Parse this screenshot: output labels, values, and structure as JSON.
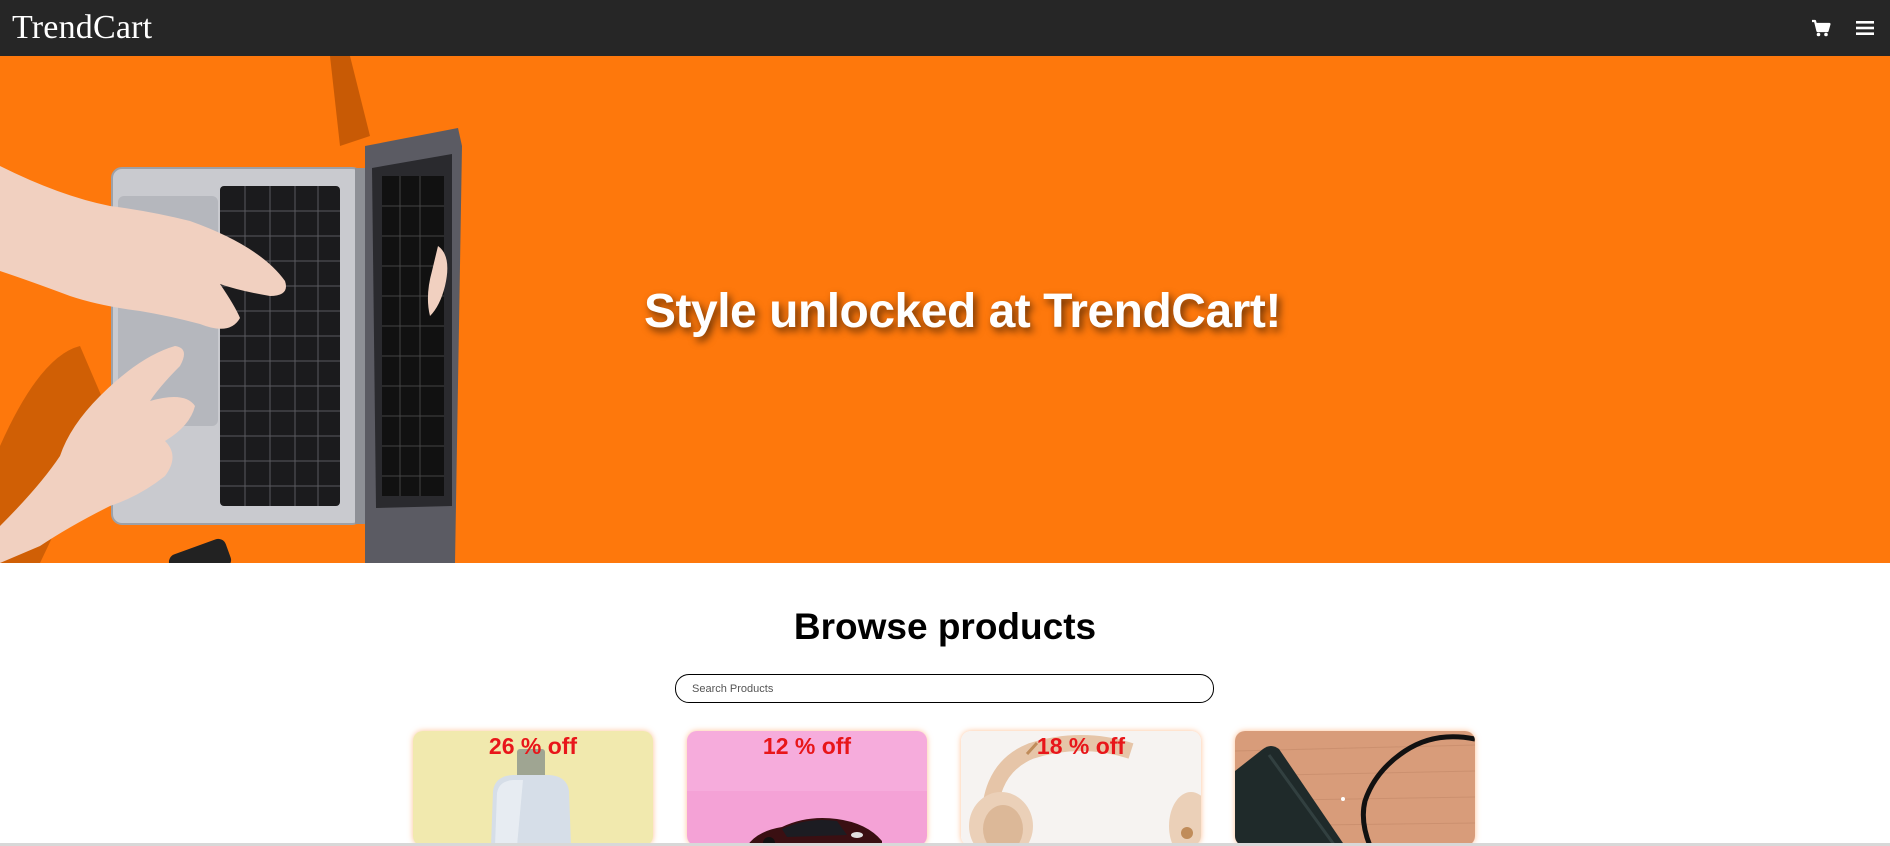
{
  "navbar": {
    "brand": "TrendCart",
    "cart_icon": "cart-icon",
    "menu_icon": "hamburger-menu-icon"
  },
  "hero": {
    "headline": "Style unlocked at TrendCart!",
    "background_color": "#fe780c",
    "image_icon": "laptop-typing-hands-image"
  },
  "browse": {
    "title": "Browse products",
    "search_placeholder": "Search Products",
    "search_value": ""
  },
  "products": [
    {
      "discount": "26 % off",
      "image": "lotion-bottle-image"
    },
    {
      "discount": "12 % off",
      "image": "toy-car-image"
    },
    {
      "discount": "18 % off",
      "image": "headphones-image"
    },
    {
      "discount": "",
      "image": "phone-cable-image"
    }
  ],
  "colors": {
    "navbar": "#262626",
    "accent": "#fe780c",
    "discount_text": "#e8161a"
  }
}
